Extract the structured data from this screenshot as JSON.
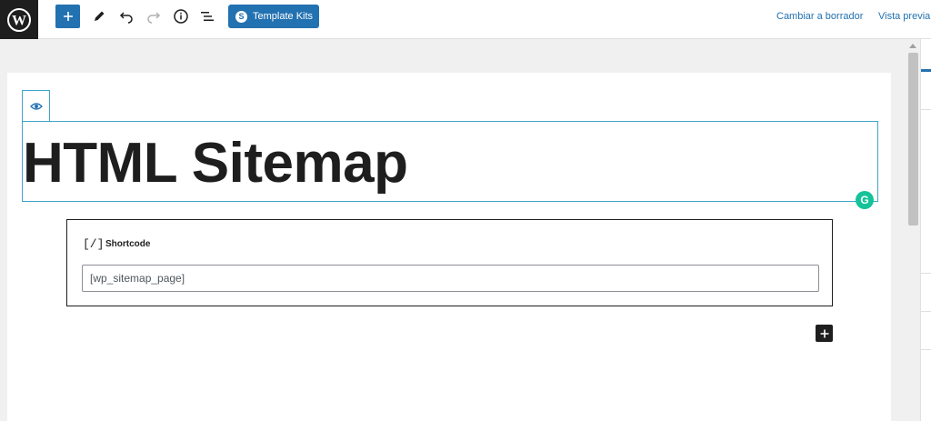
{
  "toolbar": {
    "logo_icon": "wordpress-logo",
    "add_block_icon": "plus-icon",
    "tools_icon": "pencil-icon",
    "undo_icon": "undo-icon",
    "redo_icon": "redo-icon",
    "details_icon": "info-icon",
    "list_view_icon": "list-view-icon",
    "template_kits_label": "Template Kits",
    "template_kits_icon": "S",
    "save_draft_label": "Cambiar a borrador",
    "preview_label": "Vista previa"
  },
  "editor": {
    "visibility_icon": "eye-icon",
    "title": "HTML Sitemap",
    "grammarly_icon": "G",
    "shortcode_block": {
      "icon": "[/]",
      "label": "Shortcode",
      "value": "[wp_sitemap_page]"
    },
    "inserter_icon": "plus-icon"
  },
  "colors": {
    "accent": "#2271b1",
    "focus_outline": "#3fa5c9",
    "text": "#1e1e1e",
    "grammarly": "#15c39a"
  }
}
